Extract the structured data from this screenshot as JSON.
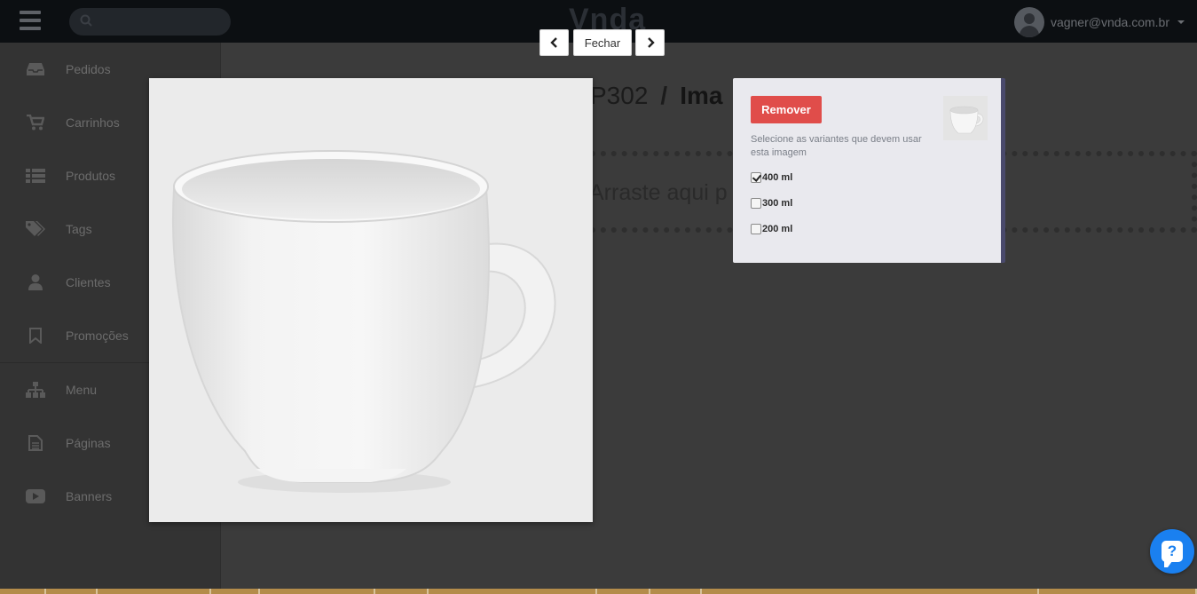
{
  "topbar": {
    "brand": "Vnda",
    "user_email": "vagner@vnda.com.br"
  },
  "sidebar": {
    "items": [
      {
        "label": "Pedidos",
        "icon": "inbox-icon"
      },
      {
        "label": "Carrinhos",
        "icon": "cart-icon"
      },
      {
        "label": "Produtos",
        "icon": "list-icon"
      },
      {
        "label": "Tags",
        "icon": "tags-icon"
      },
      {
        "label": "Clientes",
        "icon": "user-icon"
      },
      {
        "label": "Promoções",
        "icon": "bookmark-icon"
      },
      {
        "label": "Menu",
        "icon": "sitemap-icon"
      },
      {
        "label": "Páginas",
        "icon": "file-icon"
      },
      {
        "label": "Banners",
        "icon": "youtube-play-icon"
      }
    ]
  },
  "content": {
    "title_code": "P302",
    "title_section": "Ima",
    "dropzone_text": "Arraste aqui p"
  },
  "lightbox": {
    "close_label": "Fechar"
  },
  "panel": {
    "remove_label": "Remover",
    "hint": "Selecione as variantes que devem usar esta imagem",
    "variants": [
      {
        "label": "400 ml",
        "checked": true
      },
      {
        "label": "300 ml",
        "checked": false
      },
      {
        "label": "200 ml",
        "checked": false
      }
    ]
  },
  "help": {
    "label": "?"
  },
  "colors": {
    "remove_button": "#e04d4a",
    "help_button": "#1a80f0",
    "topbar": "#0c0f12"
  }
}
